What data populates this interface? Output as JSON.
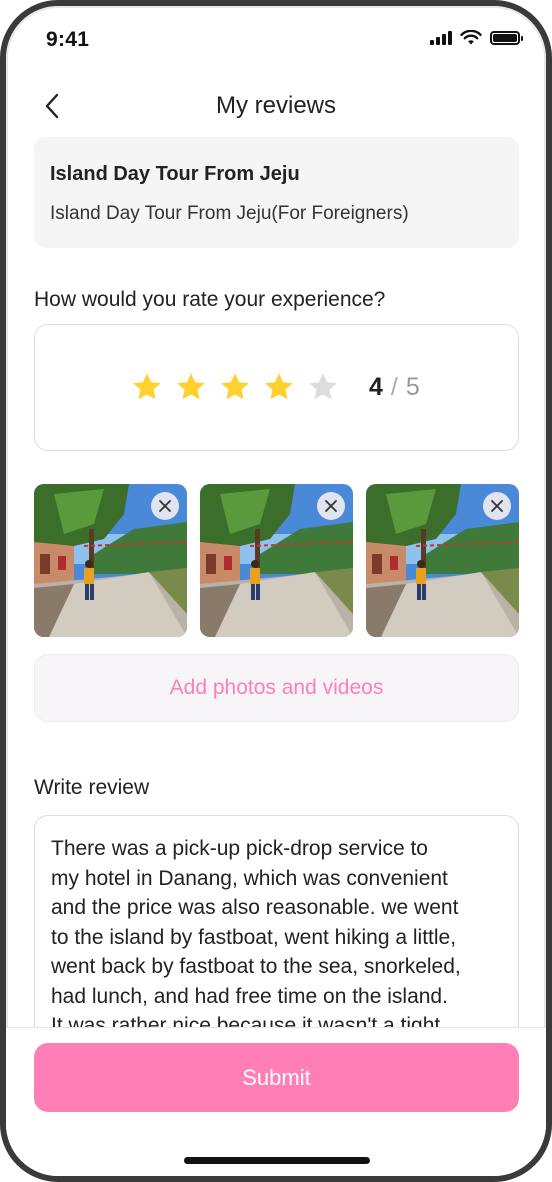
{
  "status_bar": {
    "time": "9:41"
  },
  "header": {
    "title": "My reviews",
    "back_icon": "chevron-left-icon"
  },
  "product": {
    "title": "Island Day Tour From Jeju",
    "subtitle": "Island Day Tour From Jeju(For Foreigners)"
  },
  "rating": {
    "question": "How would you rate your experience?",
    "value": "4",
    "max": "5",
    "separator": "/",
    "filled_color": "#FFD12E",
    "empty_color": "#DDDDDD"
  },
  "photos": [
    {
      "name": "photo-1",
      "remove_icon": "close-icon"
    },
    {
      "name": "photo-2",
      "remove_icon": "close-icon"
    },
    {
      "name": "photo-3",
      "remove_icon": "close-icon"
    }
  ],
  "add_media": {
    "label": "Add photos and videos"
  },
  "review": {
    "label": "Write review",
    "lines": [
      "There was a pick-up pick-drop service to",
      "my hotel in Danang, which was convenient",
      "and the price was also reasonable. we went",
      "to the island by fastboat, went hiking a little,",
      "went back by fastboat to the sea, snorkeled,",
      "had lunch, and had free time on the island.",
      "It was rather nice because it wasn't a tight"
    ]
  },
  "submit": {
    "label": "Submit"
  },
  "colors": {
    "accent": "#FF7EB6",
    "star": "#FFD12E"
  }
}
